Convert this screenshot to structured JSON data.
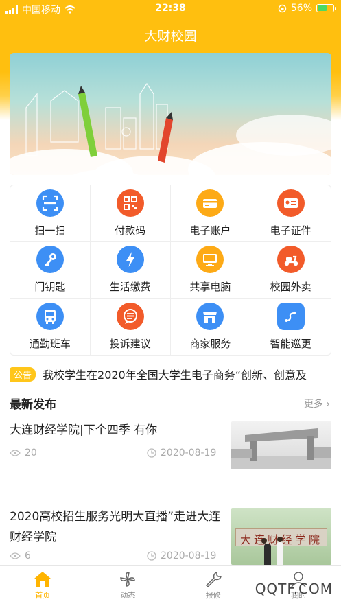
{
  "status": {
    "carrier": "中国移动",
    "time": "22:38",
    "battery": "56%"
  },
  "header": {
    "title": "大财校园"
  },
  "grid": [
    {
      "label": "扫一扫",
      "icon": "scan-icon",
      "color": "#3d8ff5"
    },
    {
      "label": "付款码",
      "icon": "qrcode-icon",
      "color": "#f25b2a"
    },
    {
      "label": "电子账户",
      "icon": "card-icon",
      "color": "#fdaa16"
    },
    {
      "label": "电子证件",
      "icon": "id-card-icon",
      "color": "#f25b2a"
    },
    {
      "label": "门钥匙",
      "icon": "key-icon",
      "color": "#3d8ff5"
    },
    {
      "label": "生活缴费",
      "icon": "lightning-icon",
      "color": "#3d8ff5"
    },
    {
      "label": "共享电脑",
      "icon": "monitor-icon",
      "color": "#fdaa16"
    },
    {
      "label": "校园外卖",
      "icon": "scooter-icon",
      "color": "#f25b2a"
    },
    {
      "label": "通勤班车",
      "icon": "bus-icon",
      "color": "#3d8ff5"
    },
    {
      "label": "投诉建议",
      "icon": "message-icon",
      "color": "#f25b2a"
    },
    {
      "label": "商家服务",
      "icon": "shop-icon",
      "color": "#3d8ff5"
    },
    {
      "label": "智能巡更",
      "icon": "route-icon",
      "color": "#3d8ff5"
    }
  ],
  "notice": {
    "tag": "公告",
    "text": "我校学生在2020年全国大学生电子商务“创新、创意及"
  },
  "latest": {
    "title": "最新发布",
    "more": "更多",
    "articles": [
      {
        "title": "大连财经学院|下个四季 有你",
        "views": "20",
        "date": "2020-08-19"
      },
      {
        "title": "2020高校招生服务光明大直播”走进大连财经学院",
        "views": "6",
        "date": "2020-08-19",
        "sign_text": "大连财经学院"
      }
    ]
  },
  "tabs": [
    {
      "label": "首页",
      "icon": "home-icon"
    },
    {
      "label": "动态",
      "icon": "pinwheel-icon"
    },
    {
      "label": "报修",
      "icon": "wrench-icon"
    },
    {
      "label": "我的",
      "icon": "user-icon"
    }
  ],
  "watermark": "QQTF.COM",
  "colors": {
    "brand": "#ffbf0f",
    "blue": "#3d8ff5",
    "orange": "#f25b2a",
    "amber": "#fdaa16"
  }
}
